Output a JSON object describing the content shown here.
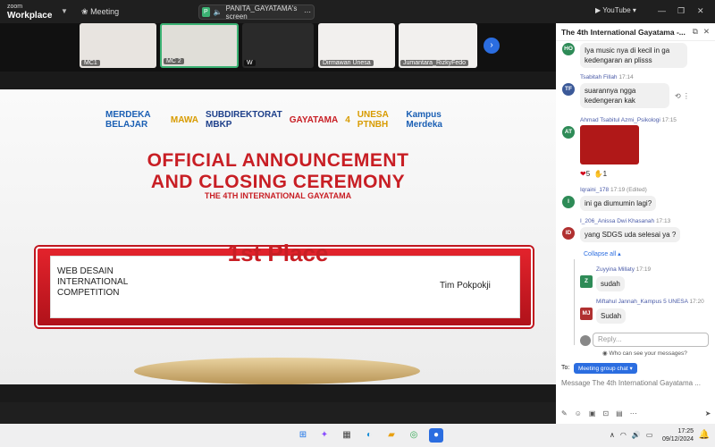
{
  "app": {
    "brand_line1": "zoom",
    "brand_line2": "Workplace",
    "meeting_label": "Meeting",
    "screen_share_label": "PANITA_GAYATAMA's screen",
    "share_badge": "P",
    "youtube_label": "YouTube"
  },
  "participants": [
    {
      "name": "MC1"
    },
    {
      "name": "MC 2"
    },
    {
      "name": "W"
    },
    {
      "name": "Dirmawan Unesa"
    },
    {
      "name": "Jumantara_RizkyFedo"
    }
  ],
  "slide": {
    "logos": [
      "MERDEKA BELAJAR",
      "MAWA",
      "SUBDIREKTORAT MBKP",
      "GAYATAMA",
      "4",
      "UNESA PTNBH",
      "Kampus Merdeka"
    ],
    "title_line1": "OFFICIAL ANNOUNCEMENT",
    "title_line2": "AND CLOSING CEREMONY",
    "subtitle": "THE 4TH INTERNATIONAL GAYATAMA",
    "place": "1st Place",
    "competition": "WEB DESAIN INTERNATIONAL COMPETITION",
    "team": "Tim Pokpokji"
  },
  "chat": {
    "title": "The 4th International Gayatama -...",
    "messages": [
      {
        "initials": "HO",
        "color": "#2e8b57",
        "sender": "",
        "time": "",
        "text": "Iya music nya di kecil in ga kedengaran an plisss"
      },
      {
        "initials": "TF",
        "color": "#3b5998",
        "sender": "Tsabitah Fillah",
        "time": "17:14",
        "text": "suarannya ngga kedengeran kak"
      },
      {
        "initials": "AT",
        "color": "#2e8b57",
        "sender": "Ahmad Tsabitul Azmi_Psikologi",
        "time": "17:15",
        "text": ""
      },
      {
        "initials": "I",
        "color": "#2e8b57",
        "sender": "Iqraini_178",
        "time": "17:19 (Edited)",
        "text": "ini ga diumumin lagi?"
      },
      {
        "initials": "ID",
        "color": "#b03030",
        "sender": "I_206_Anissa Dwi Khasanah",
        "time": "17:13",
        "text": "yang SDGS uda selesai ya ?"
      },
      {
        "initials": "Z",
        "color": "#2e8b57",
        "sender": "Zuyyina Millaty",
        "time": "17:19",
        "text": "sudah"
      },
      {
        "initials": "MJ",
        "color": "#b03030",
        "sender": "Miftahul Jannah_Kampus 5 UNESA",
        "time": "17:20",
        "text": "Sudah"
      }
    ],
    "reactions": {
      "heart_count": "5",
      "hand_count": "1"
    },
    "collapse_label": "Collapse all",
    "reply_placeholder": "Reply...",
    "who_can_see": "Who can see your messages?",
    "to_label": "To:",
    "to_target": "Meeting group chat",
    "message_placeholder": "Message The 4th International Gayatama ..."
  },
  "taskbar": {
    "time": "17:25",
    "date": "09/12/2024"
  }
}
